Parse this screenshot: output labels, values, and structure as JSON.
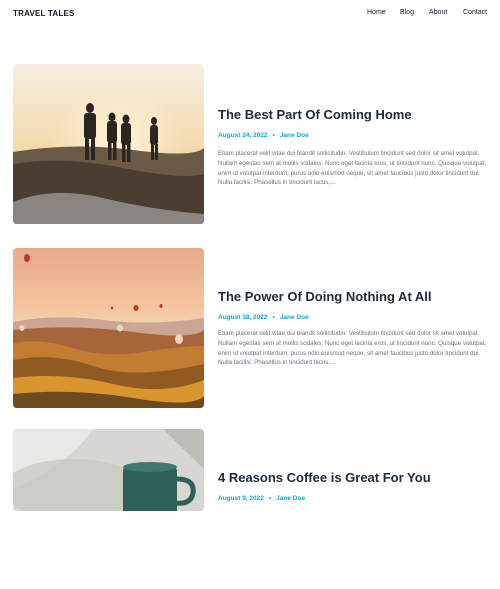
{
  "header": {
    "brand": "TRAVEL TALES",
    "nav": [
      "Home",
      "Blog",
      "About",
      "Contact"
    ]
  },
  "posts": [
    {
      "title": "The Best Part Of Coming Home",
      "date": "August 24, 2022",
      "author": "Jane Doe",
      "excerpt": "Etiam placerat velit vitae dui blandit sollicitudin. Vestibulum tincidunt sed dolor sit amet volutpat. Nullam egestas sem at mollis sodales. Nunc eget lacinia eros, ut tincidunt nunc. Quisque volutpat, enim id volutpat interdum, purus odio euismod neque, sit amet faucibus justo dolor tincidunt dui. Nulla facilisi. Phasellus in tincidunt lacus,..."
    },
    {
      "title": "The Power Of Doing Nothing At All",
      "date": "August 18, 2022",
      "author": "Jane Doe",
      "excerpt": "Etiam placerat velit vitae dui blandit sollicitudin. Vestibulum tincidunt sed dolor sit amet volutpat. Nullam egestas sem at mollis sodales. Nunc eget lacinia eros, ut tincidunt nunc. Quisque volutpat, enim id volutpat interdum, purus odio euismod neque, sit amet faucibus justo dolor tincidunt dui. Nulla facilisi. Phasellus in tincidunt lacus,..."
    },
    {
      "title": "4 Reasons Coffee is Great For You",
      "date": "August 9, 2022",
      "author": "Jane Doe"
    }
  ],
  "colors": {
    "accent": "#06a9d6",
    "title": "#1e293b",
    "body": "#6b7280"
  }
}
